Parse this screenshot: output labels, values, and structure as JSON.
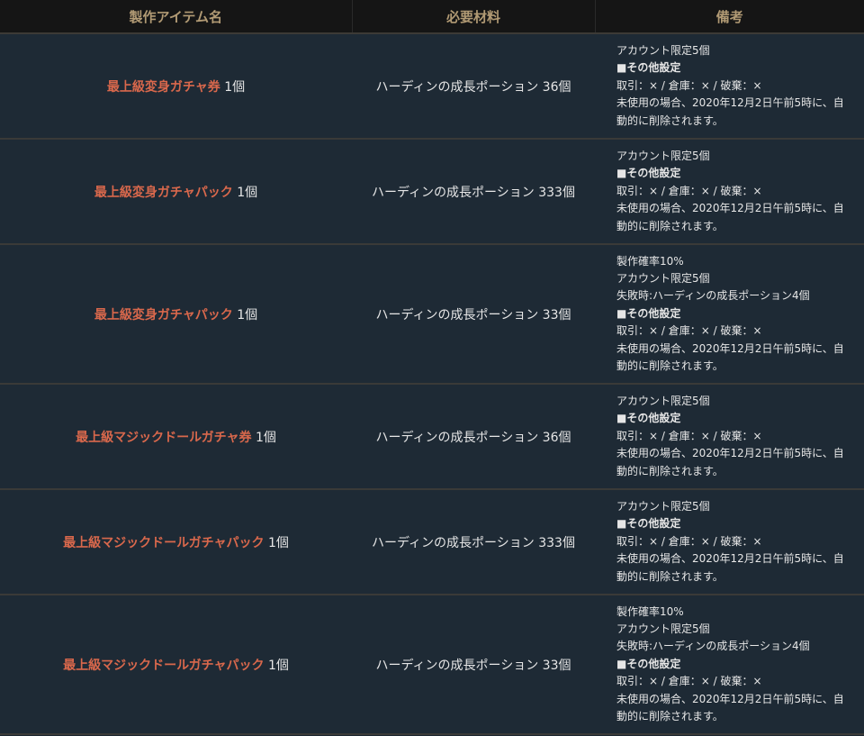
{
  "header": {
    "col_name": "製作アイテム名",
    "col_material": "必要材料",
    "col_note": "備考"
  },
  "rows": [
    {
      "name": "最上級変身ガチャ券",
      "qty": " 1個",
      "material": "ハーディンの成長ポーション 36個",
      "notes": [
        "アカウント限定5個",
        "■その他設定",
        "取引：× / 倉庫：× / 破棄：×",
        "未使用の場合、2020年12月2日午前5時に、自",
        "動的に削除されます。"
      ]
    },
    {
      "name": "最上級変身ガチャパック",
      "qty": " 1個",
      "material": "ハーディンの成長ポーション 333個",
      "notes": [
        "アカウント限定5個",
        "■その他設定",
        "取引：× / 倉庫：× / 破棄：×",
        "未使用の場合、2020年12月2日午前5時に、自",
        "動的に削除されます。"
      ]
    },
    {
      "name": "最上級変身ガチャパック",
      "qty": " 1個",
      "material": "ハーディンの成長ポーション 33個",
      "notes": [
        "製作確率10%",
        "アカウント限定5個",
        "失敗時:ハーディンの成長ポーション4個",
        "■その他設定",
        "取引：× / 倉庫：× / 破棄：×",
        "未使用の場合、2020年12月2日午前5時に、自",
        "動的に削除されます。"
      ]
    },
    {
      "name": "最上級マジックドールガチャ券",
      "qty": " 1個",
      "material": "ハーディンの成長ポーション 36個",
      "notes": [
        "アカウント限定5個",
        "■その他設定",
        "取引：× / 倉庫：× / 破棄：×",
        "未使用の場合、2020年12月2日午前5時に、自",
        "動的に削除されます。"
      ]
    },
    {
      "name": "最上級マジックドールガチャパック",
      "qty": " 1個",
      "material": "ハーディンの成長ポーション 333個",
      "notes": [
        "アカウント限定5個",
        "■その他設定",
        "取引：× / 倉庫：× / 破棄：×",
        "未使用の場合、2020年12月2日午前5時に、自",
        "動的に削除されます。"
      ]
    },
    {
      "name": "最上級マジックドールガチャパック",
      "qty": " 1個",
      "material": "ハーディンの成長ポーション 33個",
      "notes": [
        "製作確率10%",
        "アカウント限定5個",
        "失敗時:ハーディンの成長ポーション4個",
        "■その他設定",
        "取引：× / 倉庫：× / 破棄：×",
        "未使用の場合、2020年12月2日午前5時に、自",
        "動的に削除されます。"
      ]
    }
  ]
}
